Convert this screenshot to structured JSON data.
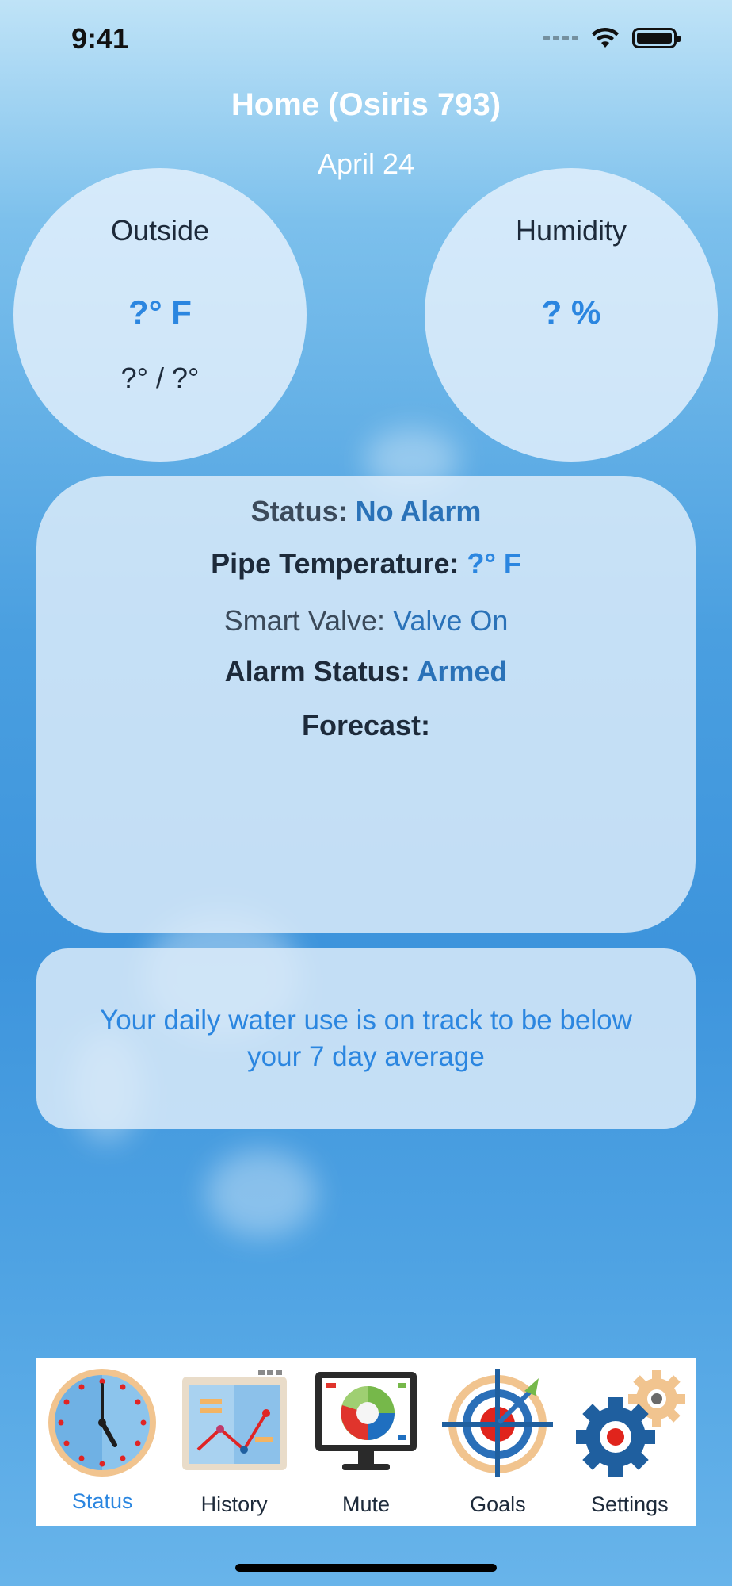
{
  "status_bar": {
    "time": "9:41"
  },
  "header": {
    "title": "Home (Osiris 793)",
    "date": "April 24"
  },
  "outside": {
    "label": "Outside",
    "temperature": "?° F",
    "high_low": "?° / ?°"
  },
  "humidity": {
    "label": "Humidity",
    "value": "? %"
  },
  "status_card": {
    "status_label": "Status: ",
    "status_value": "No Alarm",
    "pipe_label": "Pipe Temperature: ",
    "pipe_value": "?° F",
    "valve_label": "Smart Valve: ",
    "valve_value": "Valve On",
    "alarm_label": "Alarm Status: ",
    "alarm_value": "Armed",
    "forecast_label": "Forecast:"
  },
  "tip": {
    "text": "Your daily water use is on track to be below your 7 day average"
  },
  "tabs": [
    {
      "label": "Status",
      "icon": "clock-icon",
      "active": true
    },
    {
      "label": "History",
      "icon": "line-chart-icon",
      "active": false
    },
    {
      "label": "Mute",
      "icon": "pie-chart-monitor-icon",
      "active": false
    },
    {
      "label": "Goals",
      "icon": "target-icon",
      "active": false
    },
    {
      "label": "Settings",
      "icon": "gears-icon",
      "active": false
    }
  ],
  "colors": {
    "accent": "#2b86e0",
    "value_dark": "#2a72b8",
    "card": "#e1eefa"
  }
}
